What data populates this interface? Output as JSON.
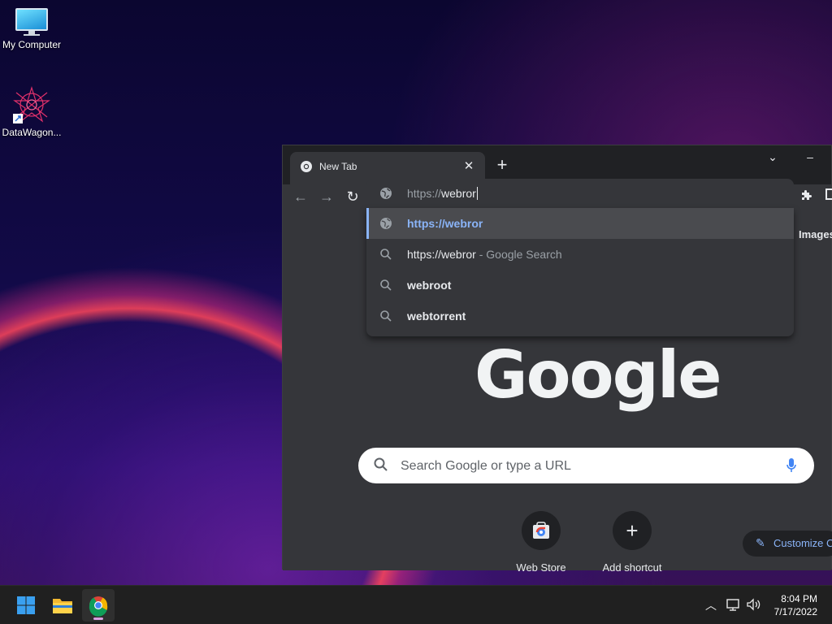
{
  "desktop": {
    "icons": [
      {
        "label": "My Computer",
        "icon": "monitor-icon"
      },
      {
        "label": "DataWagon...",
        "icon": "datawagon-logo-icon"
      }
    ]
  },
  "browser": {
    "tab": {
      "title": "New Tab"
    },
    "omnibox": {
      "scheme": "https://",
      "typed": "webror"
    },
    "suggestions": [
      {
        "icon": "globe-icon",
        "text": "https://webror",
        "suffix": "",
        "bold": true,
        "selected": true
      },
      {
        "icon": "search-icon",
        "text": "https://webror",
        "suffix": "- Google Search",
        "bold": false,
        "selected": false
      },
      {
        "icon": "search-icon",
        "text": "webroot",
        "suffix": "",
        "bold": true,
        "selected": false
      },
      {
        "icon": "search-icon",
        "text": "webtorrent",
        "suffix": "",
        "bold": true,
        "selected": false
      }
    ],
    "ntp": {
      "images_link": "Images",
      "logo": "Google",
      "search_placeholder": "Search Google or type a URL",
      "shortcuts": [
        {
          "label": "Web Store"
        },
        {
          "label": "Add shortcut"
        }
      ],
      "customize_label": "Customize C"
    }
  },
  "taskbar": {
    "time": "8:04 PM",
    "date": "7/17/2022"
  },
  "colors": {
    "accent_link": "#8ab4f8",
    "browser_bg": "#35363a",
    "frame_bg": "#202124"
  }
}
